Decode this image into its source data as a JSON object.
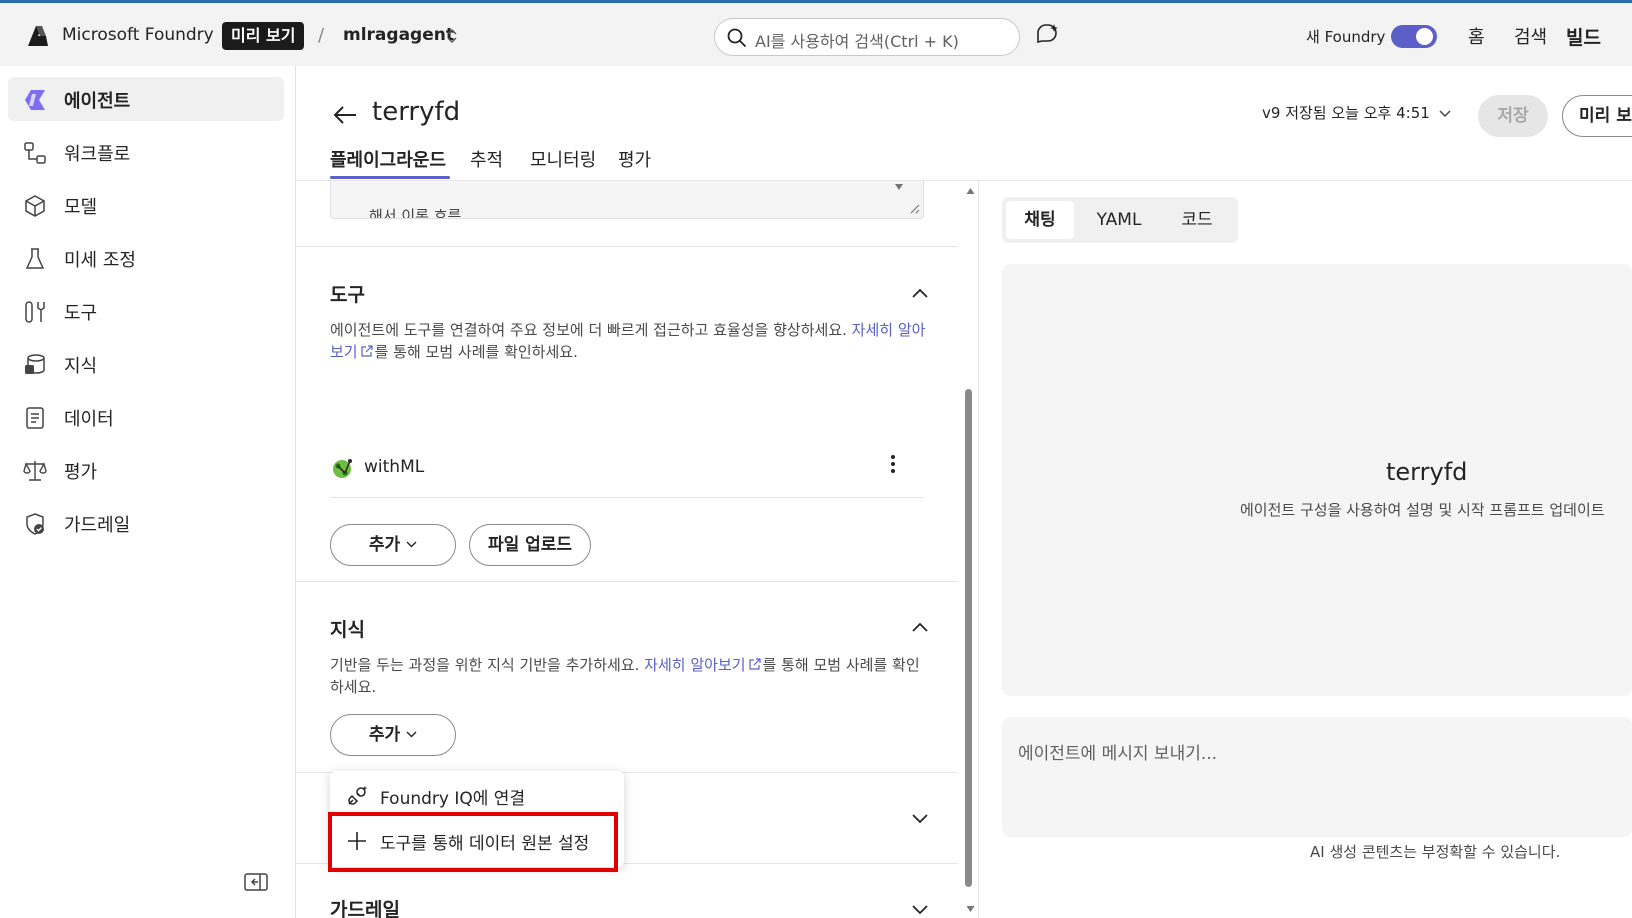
{
  "topbar": {
    "brand": "Microsoft Foundry",
    "preview_badge": "미리 보기",
    "separator": "/",
    "project": "mlragagent",
    "search_placeholder": "AI를 사용하여 검색(Ctrl + K)",
    "toggle_label": "새 Foundry",
    "toggle_on": true,
    "nav": {
      "home": "홈",
      "search": "검색",
      "build": "빌드"
    }
  },
  "sidebar": {
    "items": [
      {
        "label": "에이전트",
        "icon": "agent-icon",
        "active": true
      },
      {
        "label": "워크플로",
        "icon": "workflow-icon",
        "active": false
      },
      {
        "label": "모델",
        "icon": "model-cube-icon",
        "active": false
      },
      {
        "label": "미세 조정",
        "icon": "flask-icon",
        "active": false
      },
      {
        "label": "도구",
        "icon": "tools-icon",
        "active": false
      },
      {
        "label": "지식",
        "icon": "knowledge-database-icon",
        "active": false
      },
      {
        "label": "데이터",
        "icon": "data-document-icon",
        "active": false
      },
      {
        "label": "평가",
        "icon": "scale-icon",
        "active": false
      },
      {
        "label": "가드레일",
        "icon": "shield-check-icon",
        "active": false
      }
    ]
  },
  "header": {
    "title": "terryfd",
    "tabs": [
      "플레이그라운드",
      "추적",
      "모니터링",
      "평가"
    ],
    "active_tab": 0,
    "version": "v9 저장됨 오늘 오후 4:51",
    "save_label": "저장",
    "preview_label": "미리 보"
  },
  "config": {
    "instructions_snippet": "해서 이론 흐름",
    "tools": {
      "title": "도구",
      "desc_before": "에이전트에 도구를 연결하여 주요 정보에 더 빠르게 접근하고 효율성을 향상하세요.",
      "link": "자세히 알아보기",
      "desc_after": "를 통해 모범 사례를 확인하세요.",
      "items": [
        {
          "name": "withML"
        }
      ],
      "add_label": "추가",
      "upload_label": "파일 업로드"
    },
    "knowledge": {
      "title": "지식",
      "desc_before": "기반을 두는 과정을 위한 지식 기반을 추가하세요.",
      "link": "자세히 알아보기",
      "desc_after": "를 통해 모범 사례를 확인하세요.",
      "add_label": "추가",
      "dropdown": [
        {
          "label": "Foundry IQ에 연결",
          "icon": "plug-sparkle-icon"
        },
        {
          "label": "도구를 통해 데이터 원본 설정",
          "icon": "plus-icon"
        }
      ]
    },
    "guardrails": {
      "title": "가드레일"
    }
  },
  "chat": {
    "tabs": [
      "채팅",
      "YAML",
      "코드"
    ],
    "active_tab": 0,
    "agent_name": "terryfd",
    "agent_desc": "에이전트 구성을 사용하여 설명 및 시작 프롬프트 업데이트",
    "message_placeholder": "에이전트에 메시지 보내기...",
    "disclaimer": "AI 생성 콘텐츠는 부정확할 수 있습니다."
  },
  "colors": {
    "accent": "#5b5fc7",
    "highlight": "#e00000",
    "link": "#5b5fc7"
  }
}
